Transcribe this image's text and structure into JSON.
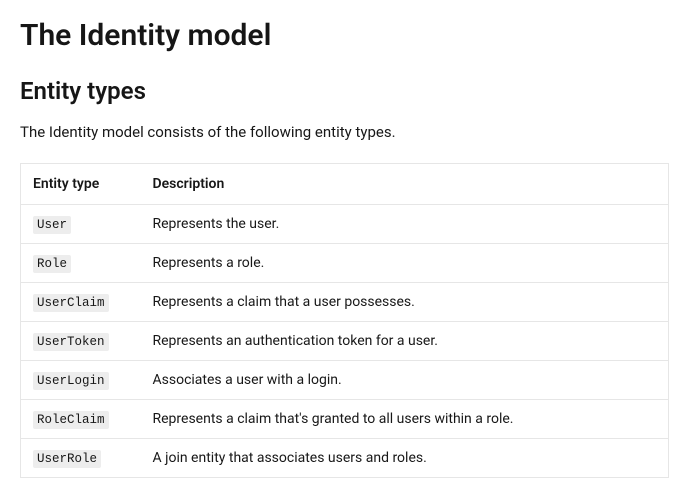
{
  "heading": "The Identity model",
  "subheading": "Entity types",
  "intro": "The Identity model consists of the following entity types.",
  "table": {
    "headers": {
      "entity": "Entity type",
      "description": "Description"
    },
    "rows": [
      {
        "entity": "User",
        "description": "Represents the user."
      },
      {
        "entity": "Role",
        "description": "Represents a role."
      },
      {
        "entity": "UserClaim",
        "description": "Represents a claim that a user possesses."
      },
      {
        "entity": "UserToken",
        "description": "Represents an authentication token for a user."
      },
      {
        "entity": "UserLogin",
        "description": "Associates a user with a login."
      },
      {
        "entity": "RoleClaim",
        "description": "Represents a claim that's granted to all users within a role."
      },
      {
        "entity": "UserRole",
        "description": "A join entity that associates users and roles."
      }
    ]
  }
}
